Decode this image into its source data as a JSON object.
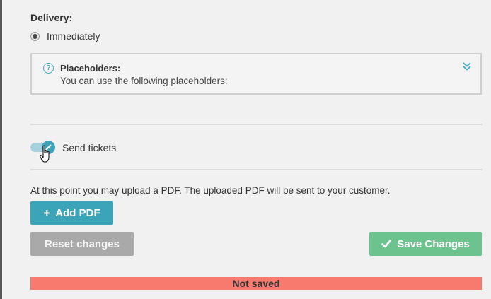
{
  "delivery": {
    "label": "Delivery:",
    "option_label": "Immediately",
    "option_selected": true
  },
  "placeholders": {
    "title": "Placeholders:",
    "text": "You can use the following placeholders:",
    "help_icon_glyph": "?",
    "expand_icon": "double-chevron-down-icon",
    "accent_color": "#45aabf"
  },
  "send_tickets": {
    "label": "Send tickets",
    "enabled": true
  },
  "upload": {
    "info_text": "At this point you may upload a PDF. The uploaded PDF will be sent to your customer.",
    "add_button_label": "Add PDF",
    "add_button_icon": "+"
  },
  "actions": {
    "reset_label": "Reset changes",
    "save_label": "Save Changes"
  },
  "status": {
    "text": "Not saved",
    "color": "#f87a6f"
  }
}
